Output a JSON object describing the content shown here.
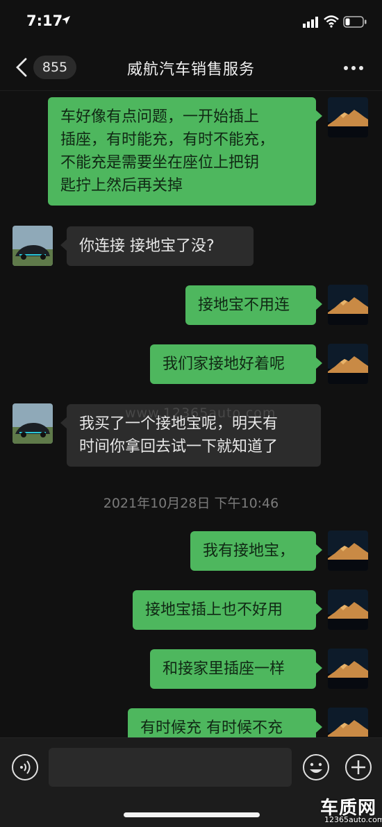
{
  "status_bar": {
    "time": "7:17"
  },
  "nav": {
    "unread_count": "855",
    "title": "威航汽车销售服务"
  },
  "messages": [
    {
      "side": "out",
      "lines": [
        "车好像有点问题，一开始插上",
        "插座，有时能充，有时不能充，",
        "不能充是需要坐在座位上把钥",
        "匙拧上然后再关掉"
      ]
    },
    {
      "side": "in",
      "lines": [
        "你连接  接地宝了没?"
      ]
    },
    {
      "side": "out",
      "lines": [
        "接地宝不用连"
      ]
    },
    {
      "side": "out",
      "lines": [
        "我们家接地好着呢"
      ]
    },
    {
      "side": "in",
      "lines": [
        "我买了一个接地宝呢，明天有",
        "时间你拿回去试一下就知道了"
      ]
    },
    {
      "side": "out",
      "lines": [
        "我有接地宝，"
      ]
    },
    {
      "side": "out",
      "lines": [
        "接地宝插上也不好用"
      ]
    },
    {
      "side": "out",
      "lines": [
        "和接家里插座一样"
      ]
    },
    {
      "side": "out",
      "lines": [
        "有时候充 有时候不充"
      ]
    }
  ],
  "timestamp": "2021年10月28日 下午10:46",
  "watermark": "www.12365auto.com",
  "corner_logo": {
    "name": "车质网",
    "url": "12365auto.com"
  },
  "colors": {
    "background": "#111111",
    "outgoing_bubble": "#4eb75e",
    "incoming_bubble": "#2c2c2c",
    "input_bar": "#1c1c1c"
  }
}
